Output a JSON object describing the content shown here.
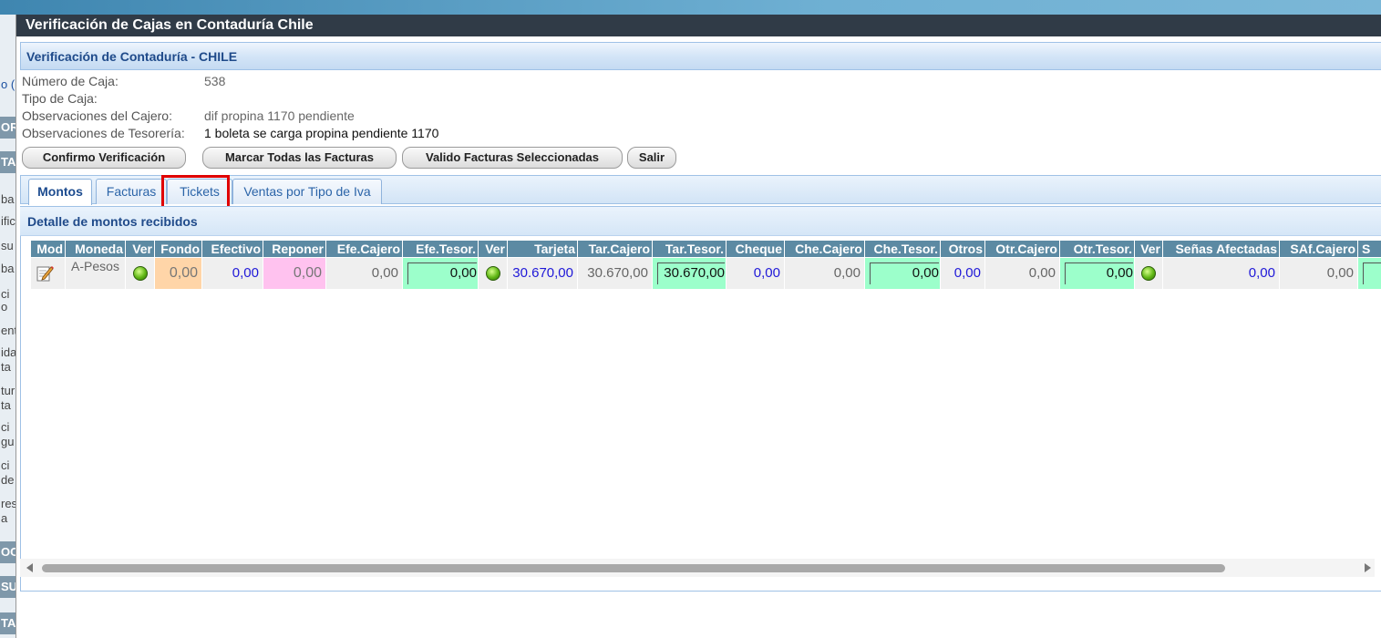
{
  "background": {
    "sidebar_fragments": [
      "o (",
      "OR",
      "TA",
      "ba",
      "ific",
      "su",
      "ba",
      "ci",
      "o",
      "ent",
      "ida",
      "ta",
      "tur",
      "ta",
      "ci",
      "gu",
      "ci",
      "de",
      "res",
      "a",
      "OC",
      "SU",
      "TA"
    ]
  },
  "window": {
    "title": "Verificación de Cajas en Contaduría Chile"
  },
  "panel": {
    "title": "Verificación de Contaduría - CHILE"
  },
  "info": {
    "numero_caja_label": "Número de Caja:",
    "numero_caja_value": "538",
    "tipo_caja_label": "Tipo de Caja:",
    "tipo_caja_value": "",
    "obs_cajero_label": "Observaciones del Cajero:",
    "obs_cajero_value": "dif propina 1170 pendiente",
    "obs_tesoreria_label": "Observaciones de Tesorería:",
    "obs_tesoreria_value": "1 boleta se carga propina pendiente 1170"
  },
  "buttons": {
    "confirmo": "Confirmo Verificación",
    "marcar": "Marcar Todas las Facturas",
    "valido": "Valido Facturas Seleccionadas",
    "salir": "Salir"
  },
  "tabs": [
    "Montos",
    "Facturas",
    "Tickets",
    "Ventas por Tipo de Iva"
  ],
  "active_tab": "Montos",
  "highlighted_tab": "Tickets",
  "detail": {
    "title": "Detalle de montos recibidos"
  },
  "grid": {
    "headers": [
      "Mod",
      "Moneda",
      "Ver",
      "Fondo",
      "Efectivo",
      "Reponer",
      "Efe.Cajero",
      "Efe.Tesor.",
      "Ver",
      "Tarjeta",
      "Tar.Cajero",
      "Tar.Tesor.",
      "Cheque",
      "Che.Cajero",
      "Che.Tesor.",
      "Otros",
      "Otr.Cajero",
      "Otr.Tesor.",
      "Ver",
      "Señas Afectadas",
      "SAf.Cajero",
      "S"
    ],
    "row": {
      "moneda": "A-Pesos",
      "fondo": "0,00",
      "efectivo": "0,00",
      "reponer": "0,00",
      "efe_cajero": "0,00",
      "efe_tesor": "0,00",
      "tarjeta": "30.670,00",
      "tar_cajero": "30.670,00",
      "tar_tesor": "30.670,00",
      "cheque": "0,00",
      "che_cajero": "0,00",
      "che_tesor": "0,00",
      "otros": "0,00",
      "otr_cajero": "0,00",
      "otr_tesor": "0,00",
      "senas_afectadas": "0,00",
      "saf_cajero": "0,00"
    }
  },
  "colors": {
    "titlebar": "#303b47",
    "header_cell": "#5c8aa3",
    "highlight": "#e00000",
    "fondo_bg": "#ffd5a8",
    "reponer_bg": "#ffc2ef",
    "tesor_bg": "#9cffcb",
    "value_blue": "#1f18d8"
  }
}
